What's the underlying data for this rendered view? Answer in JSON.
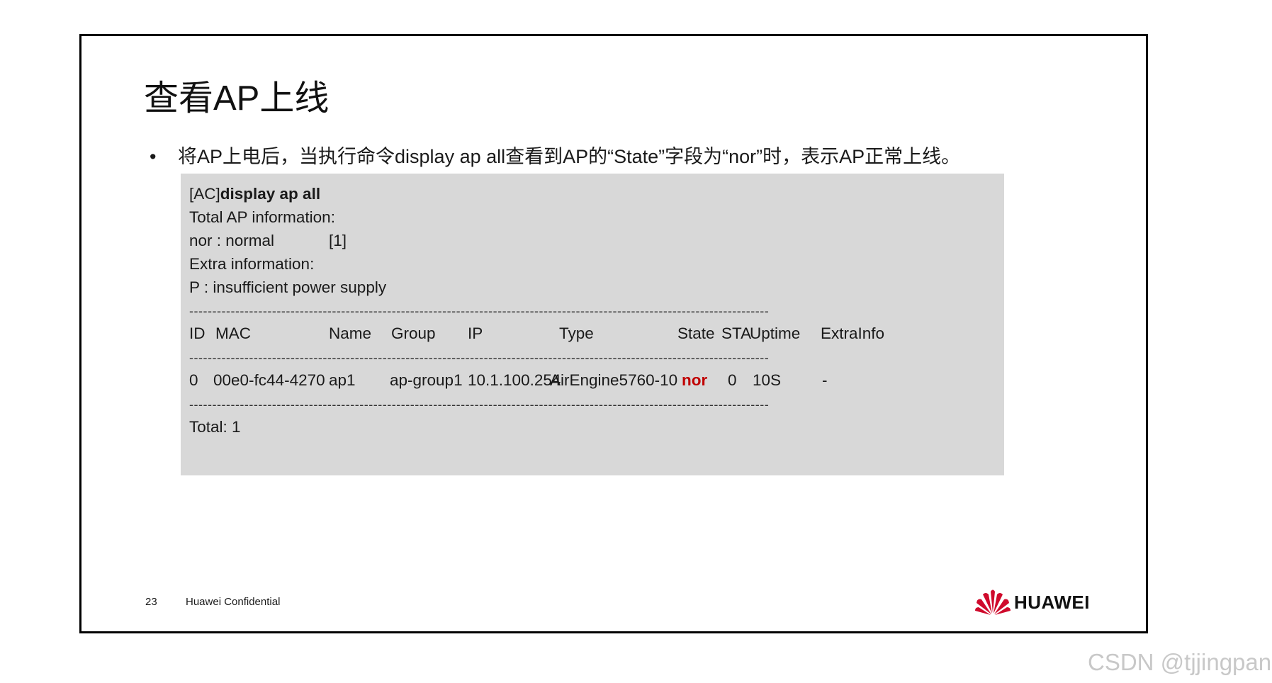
{
  "slide": {
    "title": "查看AP上线",
    "bullet_symbol": "•",
    "bullet_text": "将AP上电后，当执行命令display ap all查看到AP的“State”字段为“nor”时，表示AP正常上线。"
  },
  "code": {
    "prompt": "[AC]",
    "command": "display ap all",
    "line_total_info": "Total AP information:",
    "legend_nor_key": "nor  : normal",
    "legend_nor_count": "[1]",
    "line_extra": "Extra information:",
    "legend_p": "P  : insufficient power supply",
    "dashes": "------------------------------------------------------------------------------------------------------------------------------",
    "headers": [
      "ID",
      "MAC",
      "Name",
      "Group",
      "IP",
      "Type",
      "State",
      "STA",
      "Uptime",
      "ExtraInfo"
    ],
    "row": [
      "0",
      "00e0-fc44-4270",
      "ap1",
      "ap-group1",
      "10.1.100.254",
      "AirEngine5760-10",
      "nor",
      "0",
      "10S",
      "-"
    ],
    "total": "Total: 1"
  },
  "footer": {
    "page_number": "23",
    "confidential": "Huawei Confidential",
    "brand": "HUAWEI"
  },
  "watermark": "CSDN @tjjingpan",
  "colors": {
    "state_highlight": "#c00000",
    "code_background": "#d8d8d8",
    "logo_red": "#cf0a2c"
  }
}
